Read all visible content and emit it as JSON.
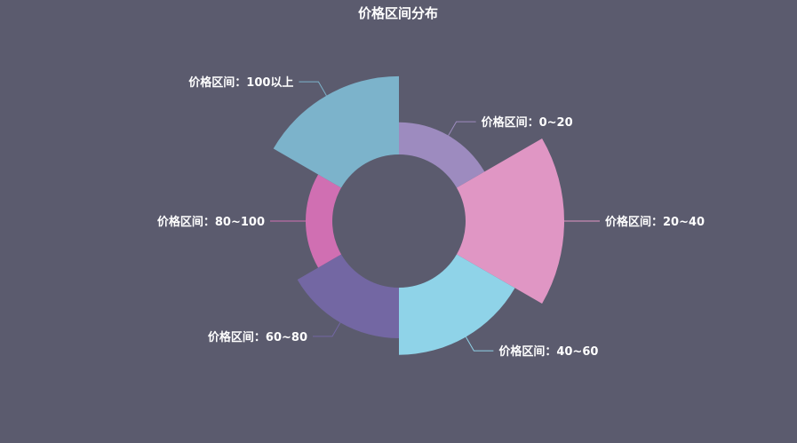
{
  "chart_data": {
    "type": "pie",
    "variant": "rose",
    "title": "价格区间分布",
    "categories": [
      "价格区间：0~20",
      "价格区间：20~40",
      "价格区间：40~60",
      "价格区间：60~80",
      "价格区间：80~100",
      "价格区间：100以上"
    ],
    "values": [
      19,
      55,
      38,
      29,
      16,
      44
    ],
    "colors": [
      "#9d8bbf",
      "#e096c4",
      "#8fd3e8",
      "#7367a3",
      "#d06fb2",
      "#7cb3cb"
    ],
    "background": "#5b5b6e",
    "legend": "none"
  }
}
